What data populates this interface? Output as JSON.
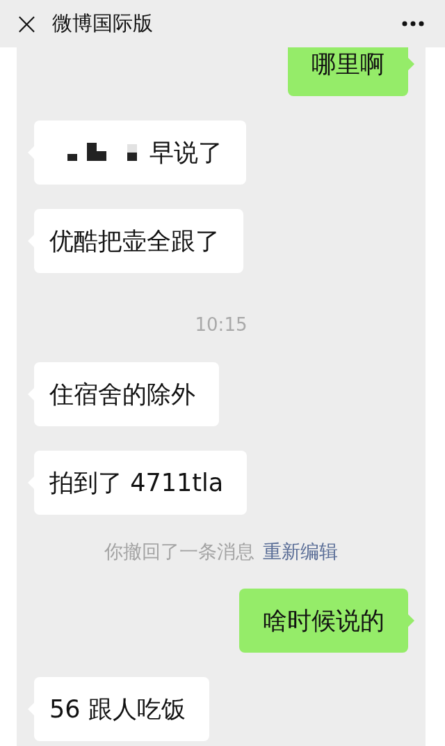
{
  "header": {
    "close": "×",
    "title": "微博国际版"
  },
  "messages": [
    {
      "kind": "outgoing",
      "text": "哪里啊",
      "redacted_prefix": false
    },
    {
      "kind": "incoming",
      "text": "早说了",
      "redacted_prefix": true
    },
    {
      "kind": "incoming",
      "text": "优酷把壶全跟了",
      "redacted_prefix": false
    },
    {
      "kind": "time",
      "text": "10:15"
    },
    {
      "kind": "incoming",
      "text": "住宿舍的除外",
      "redacted_prefix": false
    },
    {
      "kind": "incoming",
      "text": "拍到了 4711tla",
      "redacted_prefix": false
    },
    {
      "kind": "recall",
      "text": "你撤回了一条消息",
      "link": "重新编辑"
    },
    {
      "kind": "outgoing",
      "text": "啥时候说的",
      "redacted_prefix": false
    },
    {
      "kind": "incoming",
      "text": "56 跟人吃饭",
      "redacted_prefix": false
    }
  ]
}
